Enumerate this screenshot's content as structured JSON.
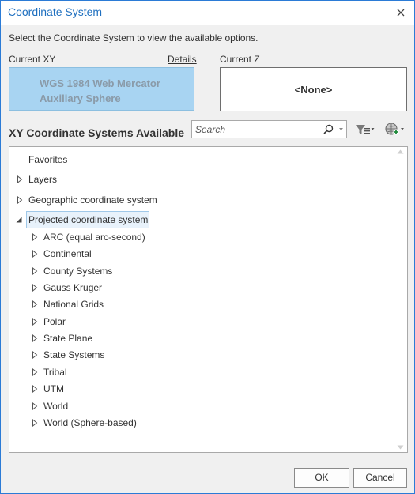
{
  "window": {
    "title": "Coordinate System"
  },
  "instructions": "Select the Coordinate System to view the available options.",
  "current_xy": {
    "label": "Current XY",
    "details_link": "Details",
    "line1": "WGS 1984 Web Mercator",
    "line2": "Auxiliary Sphere"
  },
  "current_z": {
    "label": "Current Z",
    "value": "<None>"
  },
  "xy_section": {
    "title": "XY Coordinate Systems Available"
  },
  "search": {
    "placeholder": "Search",
    "value": ""
  },
  "tree": {
    "favorites": "Favorites",
    "layers": "Layers",
    "geographic": "Geographic coordinate system",
    "projected": "Projected coordinate system",
    "projected_children": [
      "ARC (equal arc-second)",
      "Continental",
      "County Systems",
      "Gauss Kruger",
      "National Grids",
      "Polar",
      "State Plane",
      "State Systems",
      "Tribal",
      "UTM",
      "World",
      "World (Sphere-based)"
    ]
  },
  "buttons": {
    "ok": "OK",
    "cancel": "Cancel"
  },
  "colors": {
    "title": "#1e6fbf",
    "current_xy_bg": "#a8d4f2",
    "selection": "#e8f2fb"
  }
}
